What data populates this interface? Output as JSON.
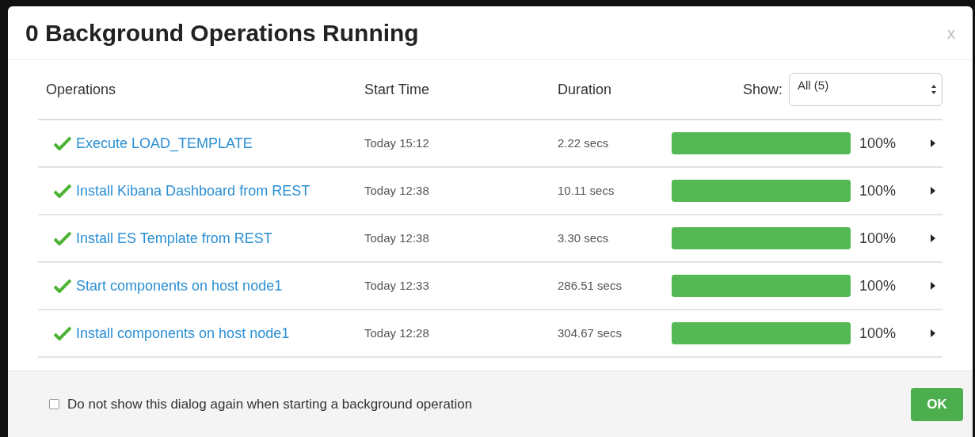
{
  "dialog": {
    "title": "0 Background Operations Running",
    "close": "x"
  },
  "columns": [
    "Operations",
    "Start Time",
    "Duration"
  ],
  "filter": {
    "label": "Show:",
    "value": "All (5)"
  },
  "operations": [
    {
      "name": "Execute LOAD_TEMPLATE",
      "done": true,
      "start_time": "Today 15:12",
      "duration": "2.22 secs",
      "level": 1,
      "percent": "100%"
    },
    {
      "name": "Install Kibana Dashboard from REST",
      "done": true,
      "start_time": "Today 12:38",
      "duration": "10.11 secs",
      "level": 1,
      "percent": "100%"
    },
    {
      "name": "Install ES Template from REST",
      "done": true,
      "start_time": "Today 12:38",
      "duration": "3.30 secs",
      "level": 1,
      "percent": "100%"
    },
    {
      "name": "Start components on host node1",
      "done": true,
      "start_time": "Today 12:33",
      "duration": "286.51 secs",
      "level": 1,
      "percent": "100%"
    },
    {
      "name": "Install components on host node1",
      "done": true,
      "start_time": "Today 12:28",
      "duration": "304.67 secs",
      "level": 1,
      "percent": "100%"
    }
  ],
  "footer": {
    "checkbox_label": "Do not show this dialog again when starting a background operation",
    "checked": false,
    "ok": "OK"
  }
}
